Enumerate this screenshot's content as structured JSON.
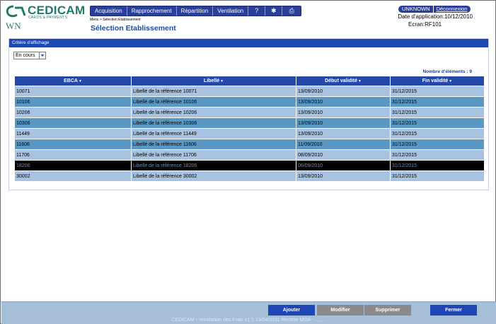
{
  "brand": {
    "name": "CEDICAM",
    "subtitle": "CARDS & PAYMENTS",
    "color": "#1f7a6a"
  },
  "user_initials": "WN",
  "menu": [
    {
      "label": "Acquisition"
    },
    {
      "label": "Rapprochement"
    },
    {
      "label": "Répartition"
    },
    {
      "label": "Ventilation"
    },
    {
      "label": "?"
    },
    {
      "label": "✱",
      "icon": "settings-icon"
    },
    {
      "label": "⎙",
      "icon": "print-icon"
    }
  ],
  "breadcrumb": "Menu > Sélection Etablissement",
  "page_title": "Sélection Etablissement",
  "user": {
    "name": "UNKNOWN",
    "logout_label": "Déconnexion"
  },
  "app_date": "Date d'application:10/12/2010",
  "screen_id": "Ecran:RF101",
  "panel": {
    "title": "Critère d'affichage",
    "filter_value": "En cours",
    "count_label": "Nombre d'éléments : 9"
  },
  "table": {
    "columns": [
      "EBCA",
      "Libellé",
      "Début validité",
      "Fin validité"
    ],
    "rows": [
      [
        "10071",
        "Libellé de la référence 10071",
        "13/09/2010",
        "31/12/2015"
      ],
      [
        "10106",
        "Libellé de la référence 10106",
        "13/09/2010",
        "31/12/2015"
      ],
      [
        "10206",
        "Libellé de la référence 10206",
        "13/09/2010",
        "31/12/2015"
      ],
      [
        "10306",
        "Libellé de la référence 10306",
        "13/09/2010",
        "31/12/2015"
      ],
      [
        "11449",
        "Libellé de la référence 11449",
        "13/09/2010",
        "31/12/2015"
      ],
      [
        "11606",
        "Libellé de la référence 11606",
        "11/09/2010",
        "31/12/2015"
      ],
      [
        "11706",
        "Libellé de la référence 11706",
        "08/09/2010",
        "31/12/2015"
      ],
      [
        "18206",
        "Libellé de la référence 18206",
        "06/09/2010",
        "31/12/2015"
      ],
      [
        "30002",
        "Libellé de la référence 30002",
        "13/09/2010",
        "31/12/2015"
      ]
    ],
    "selected_index": 7
  },
  "buttons": {
    "add": "Ajouter",
    "edit": "Modifier",
    "delete": "Supprimer",
    "close": "Fermer"
  },
  "footer_text": "CEDICAM - Ventilation des Frais v1.5 13/04/2011 Recette MOA - ........"
}
